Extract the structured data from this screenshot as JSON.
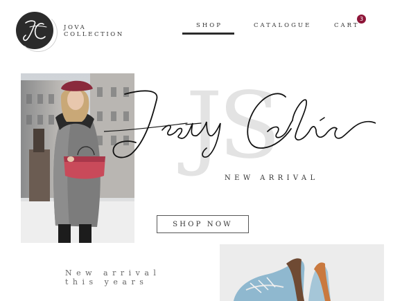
{
  "header": {
    "brand_line1": "JOVA",
    "brand_line2": "COLLECTION",
    "logo_icon": "jc-monogram-icon",
    "nav": {
      "shop": "SHOP",
      "catalogue": "CATALOGUE",
      "cart": "CART"
    },
    "cart_count": "3",
    "active_nav": "shop"
  },
  "hero": {
    "watermark": "JS",
    "script_title": "Jesty Calia",
    "subtitle": "NEW ARRIVAL",
    "cta_label": "SHOP NOW",
    "photo": "woman-with-red-handbag-photo"
  },
  "bottom": {
    "line1": "New arrival",
    "line2": "this years",
    "photo": "blue-boots-photo"
  },
  "colors": {
    "accent": "#8e1538",
    "logo_bg": "#2b2b2b",
    "watermark": "#e3e3e3",
    "text": "#333333"
  }
}
